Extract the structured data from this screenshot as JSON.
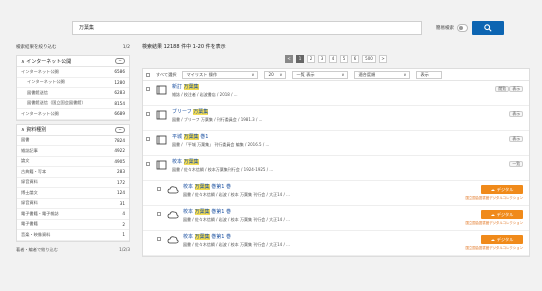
{
  "search": {
    "value": "万葉集",
    "mode_label": "簡易検索",
    "button_color": "#0d65b2"
  },
  "sidebar": {
    "narrow_label": "検索結果を絞り込む",
    "narrow_count": "1/2",
    "online": {
      "title": "インターネット公開",
      "rows": [
        {
          "label": "インターネット公開",
          "count": "6586"
        },
        {
          "label": "インターネット公開",
          "count": "1280"
        },
        {
          "label": "図書館送信",
          "count": "6283"
        },
        {
          "label": "図書館送信（国立国会図書館）",
          "count": "8154"
        },
        {
          "label": "インターネット公開",
          "count": "6689"
        }
      ]
    },
    "material": {
      "title": "資料種別",
      "rows": [
        {
          "label": "図書",
          "count": "7824"
        },
        {
          "label": "雑誌記事",
          "count": "4922"
        },
        {
          "label": "論文",
          "count": "4905"
        },
        {
          "label": "古典籍・写本",
          "count": "283"
        },
        {
          "label": "録音資料",
          "count": "172"
        },
        {
          "label": "博士論文",
          "count": "124"
        },
        {
          "label": "録音資料",
          "count": "31"
        },
        {
          "label": "電子書籍・電子雑誌",
          "count": "4"
        },
        {
          "label": "電子書籍",
          "count": "2"
        },
        {
          "label": "音楽・映像資料",
          "count": "1"
        }
      ]
    },
    "bottom_label": "著者・編者で絞り込む",
    "bottom_count": "1/2/3"
  },
  "main": {
    "result_title": "検索結果 12188 件中 1-20 件を表示",
    "pager": [
      "<",
      "1",
      "2",
      "3",
      "4",
      "5",
      "6",
      "500",
      ">"
    ],
    "toolbar": {
      "select_all": "すべて選択",
      "sort": "マイリスト 操作",
      "per_page": "20",
      "order": "一覧 表示",
      "view": "適合度順",
      "count_label": "表示"
    },
    "items": [
      {
        "title": "新訂 万葉集",
        "meta": "雑誌 / 校注者 / 岩波書店 / 2018 / ...",
        "tag": "表示",
        "tag2": "閲覧"
      },
      {
        "title": "ブリーフ 万葉集",
        "meta": "図書 / ブリーフ 万葉集 / 刊行委員会 / 1981.3 / ...",
        "tag": "表示"
      },
      {
        "title": "平城 万葉集 巻1",
        "meta": "図書 / 「平城 万葉集」 刊行委員会 編集 / 2016.5 / ...",
        "tag": "表示"
      },
      {
        "title": "校本 万葉集",
        "meta": "図書 / 佐々木信綱 / 校本万葉集刊行会 / 1924-1925 / ...",
        "tag": "一覧"
      },
      {
        "title": "校本 万葉集 巻第1 巻",
        "meta": "図書 / 佐々木信綱 / 岩波 / 校本 万葉集 刊行会 / 大正14 / ...",
        "download": "デジタル",
        "note": "国立国会図書館デジタルコレクション"
      },
      {
        "title": "校本 万葉集 巻第1 巻",
        "meta": "図書 / 佐々木信綱 / 岩波 / 校本 万葉集 刊行会 / 大正14 / ...",
        "download": "デジタル",
        "note": "国立国会図書館デジタルコレクション"
      },
      {
        "title": "校本 万葉集 巻第1 巻",
        "meta": "図書 / 佐々木信綱 / 岩波 / 校本 万葉集 刊行会 / 大正14 / ...",
        "download": "デジタル",
        "note": "国立国会図書館デジタルコレクション"
      }
    ],
    "download_color": "#f08a1a"
  }
}
